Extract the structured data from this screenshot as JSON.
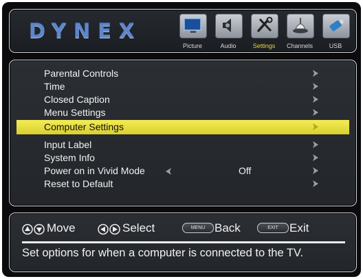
{
  "brand": {
    "logo_text": "DYNEX"
  },
  "tabs": [
    {
      "label": "Picture",
      "icon": "tv-icon"
    },
    {
      "label": "Audio",
      "icon": "speaker-icon"
    },
    {
      "label": "Settings",
      "icon": "tools-icon",
      "selected": true
    },
    {
      "label": "Channels",
      "icon": "antenna-icon"
    },
    {
      "label": "USB",
      "icon": "usb-icon"
    }
  ],
  "menu": {
    "items": [
      {
        "label": "Parental Controls"
      },
      {
        "label": "Time"
      },
      {
        "label": "Closed Caption"
      },
      {
        "label": "Menu Settings"
      },
      {
        "label": "Computer Settings",
        "selected": true
      },
      {
        "label": "Input Label"
      },
      {
        "label": "System Info"
      },
      {
        "label": "Power on in Vivid Mode",
        "value": "Off"
      },
      {
        "label": "Reset to Default"
      }
    ]
  },
  "controls": {
    "move": "Move",
    "select": "Select",
    "menu_key": "MENU",
    "back": "Back",
    "exit_key": "EXIT",
    "exit": "Exit"
  },
  "description": "Set options for when a computer is connected to the TV.",
  "colors": {
    "highlight": "#e9e142",
    "brand": "#5f86c9",
    "background": "#0b0b0d"
  }
}
